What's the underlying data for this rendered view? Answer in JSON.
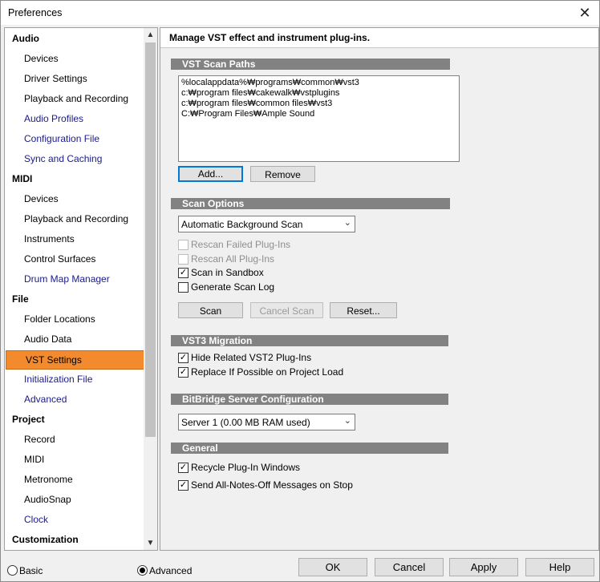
{
  "window": {
    "title": "Preferences",
    "close_glyph": "✕"
  },
  "nav": {
    "items": [
      {
        "label": "Audio",
        "kind": "group"
      },
      {
        "label": "Devices",
        "kind": "child"
      },
      {
        "label": "Driver Settings",
        "kind": "child"
      },
      {
        "label": "Playback and Recording",
        "kind": "child"
      },
      {
        "label": "Audio Profiles",
        "kind": "link"
      },
      {
        "label": "Configuration File",
        "kind": "link"
      },
      {
        "label": "Sync and Caching",
        "kind": "link"
      },
      {
        "label": "MIDI",
        "kind": "group"
      },
      {
        "label": "Devices",
        "kind": "child"
      },
      {
        "label": "Playback and Recording",
        "kind": "child"
      },
      {
        "label": "Instruments",
        "kind": "child"
      },
      {
        "label": "Control Surfaces",
        "kind": "child"
      },
      {
        "label": "Drum Map Manager",
        "kind": "link"
      },
      {
        "label": "File",
        "kind": "group"
      },
      {
        "label": "Folder Locations",
        "kind": "child"
      },
      {
        "label": "Audio Data",
        "kind": "child"
      },
      {
        "label": "VST Settings",
        "kind": "selected"
      },
      {
        "label": "Initialization File",
        "kind": "link"
      },
      {
        "label": "Advanced",
        "kind": "link"
      },
      {
        "label": "Project",
        "kind": "group"
      },
      {
        "label": "Record",
        "kind": "child"
      },
      {
        "label": "MIDI",
        "kind": "child"
      },
      {
        "label": "Metronome",
        "kind": "child"
      },
      {
        "label": "AudioSnap",
        "kind": "child"
      },
      {
        "label": "Clock",
        "kind": "link"
      },
      {
        "label": "Customization",
        "kind": "group"
      }
    ]
  },
  "content": {
    "heading": "Manage VST effect and instrument plug-ins.",
    "scan_paths": {
      "title": "VST Scan Paths",
      "paths": [
        "%localappdata%₩programs₩common₩vst3",
        "c:₩program files₩cakewalk₩vstplugins",
        "c:₩program files₩common files₩vst3",
        "C:₩Program Files₩Ample Sound"
      ],
      "add_label": "Add...",
      "remove_label": "Remove"
    },
    "scan_options": {
      "title": "Scan Options",
      "mode": "Automatic Background Scan",
      "rescan_failed": {
        "label": "Rescan Failed Plug-Ins",
        "checked": false,
        "enabled": false
      },
      "rescan_all": {
        "label": "Rescan All Plug-Ins",
        "checked": false,
        "enabled": false
      },
      "sandbox": {
        "label": "Scan in Sandbox",
        "checked": true,
        "enabled": true
      },
      "scan_log": {
        "label": "Generate Scan Log",
        "checked": false,
        "enabled": true
      },
      "scan_label": "Scan",
      "cancel_scan_label": "Cancel Scan",
      "reset_label": "Reset..."
    },
    "vst3_migration": {
      "title": "VST3 Migration",
      "hide_vst2": {
        "label": "Hide Related VST2 Plug-Ins",
        "checked": true
      },
      "replace": {
        "label": "Replace If Possible on Project Load",
        "checked": true
      }
    },
    "bitbridge": {
      "title": "BitBridge Server Configuration",
      "server": "Server 1  (0.00  MB RAM used)"
    },
    "general": {
      "title": "General",
      "recycle": {
        "label": "Recycle Plug-In Windows",
        "checked": true
      },
      "notes_off": {
        "label": "Send All-Notes-Off Messages on Stop",
        "checked": true
      }
    }
  },
  "footer": {
    "basic_label": "Basic",
    "advanced_label": "Advanced",
    "mode_selected": "Advanced",
    "ok_label": "OK",
    "cancel_label": "Cancel",
    "apply_label": "Apply",
    "help_label": "Help"
  },
  "icons": {
    "check": "✓",
    "combo_arrow": "⌄",
    "scroll_up": "▲",
    "scroll_down": "▼"
  }
}
